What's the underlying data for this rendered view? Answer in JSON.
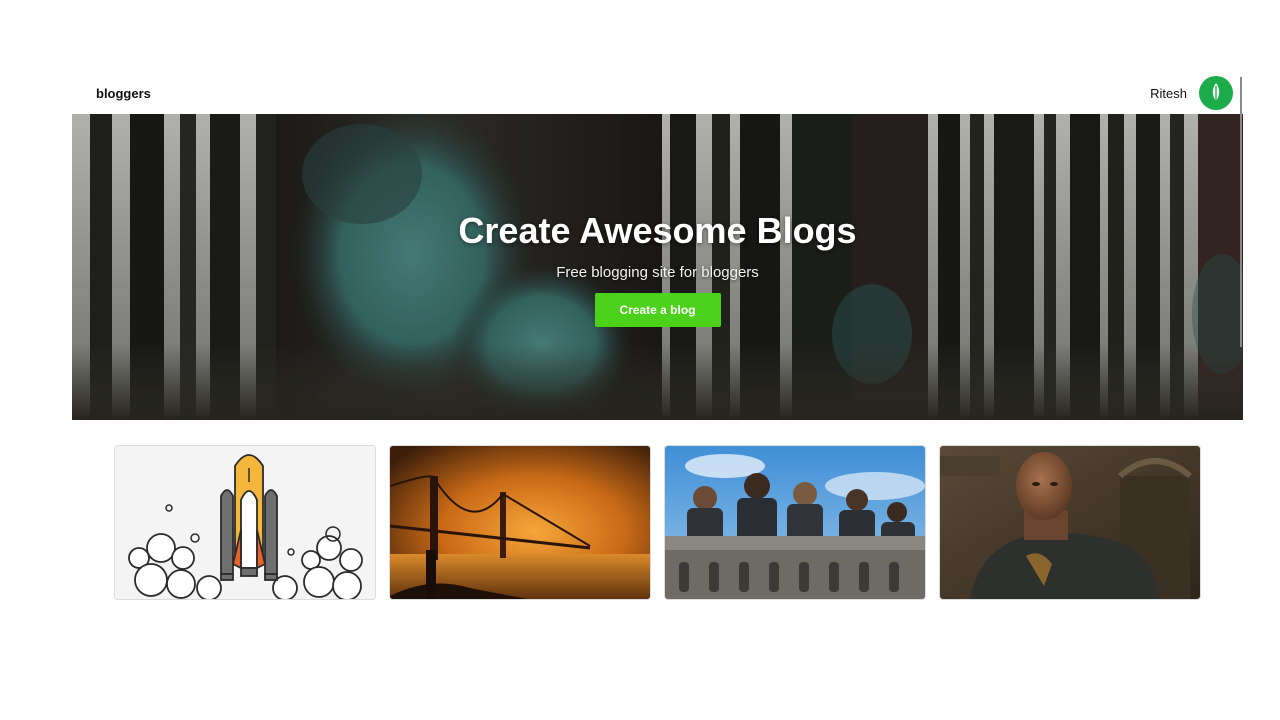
{
  "navbar": {
    "logo": "bloggers",
    "username": "Ritesh",
    "avatar_color": "#1aad4a"
  },
  "hero": {
    "title": "Create Awesome Blogs",
    "subtitle": "Free blogging site for bloggers",
    "cta_label": "Create a blog",
    "cta_color": "#4cd21a"
  },
  "cards": [
    {
      "image": "rocket-launch-illustration"
    },
    {
      "image": "foggy-bridge-photo"
    },
    {
      "image": "children-on-balcony-photo"
    },
    {
      "image": "man-in-black-suit-photo"
    }
  ]
}
